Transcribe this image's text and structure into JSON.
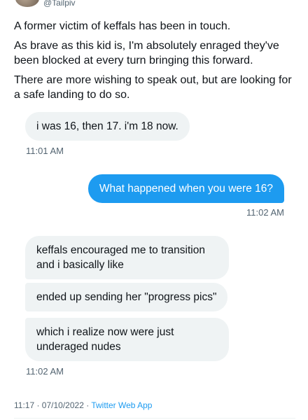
{
  "author": {
    "handle": "@Tailpiv"
  },
  "tweet": {
    "paragraphs": [
      "A former victim of keffals has been in touch.",
      "As brave as this kid is, I'm absolutely enraged they've been blocked at every turn bringing this forward.",
      "There are more wishing to speak out, but are looking for a safe landing to do so."
    ]
  },
  "dm": {
    "messages": [
      {
        "side": "left",
        "text": "i was 16, then 17. i'm 18 now."
      },
      {
        "side": "left",
        "time": "11:01 AM"
      },
      {
        "side": "right",
        "text": "What happened when you were 16?"
      },
      {
        "side": "right",
        "time": "11:02 AM"
      },
      {
        "side": "left",
        "text": "keffals encouraged me to transition and i basically like"
      },
      {
        "side": "left",
        "text": "ended up sending her \"progress pics\""
      },
      {
        "side": "left",
        "text": "which i realize now were just underaged nudes"
      },
      {
        "side": "left",
        "time": "11:02 AM"
      }
    ]
  },
  "footer": {
    "timestamp": "11:17 · 07/10/2022 · ",
    "source": "Twitter Web App"
  },
  "colors": {
    "accent": "#1d9bf0",
    "bubble_gray": "#eff3f4",
    "text_secondary": "#536471"
  }
}
